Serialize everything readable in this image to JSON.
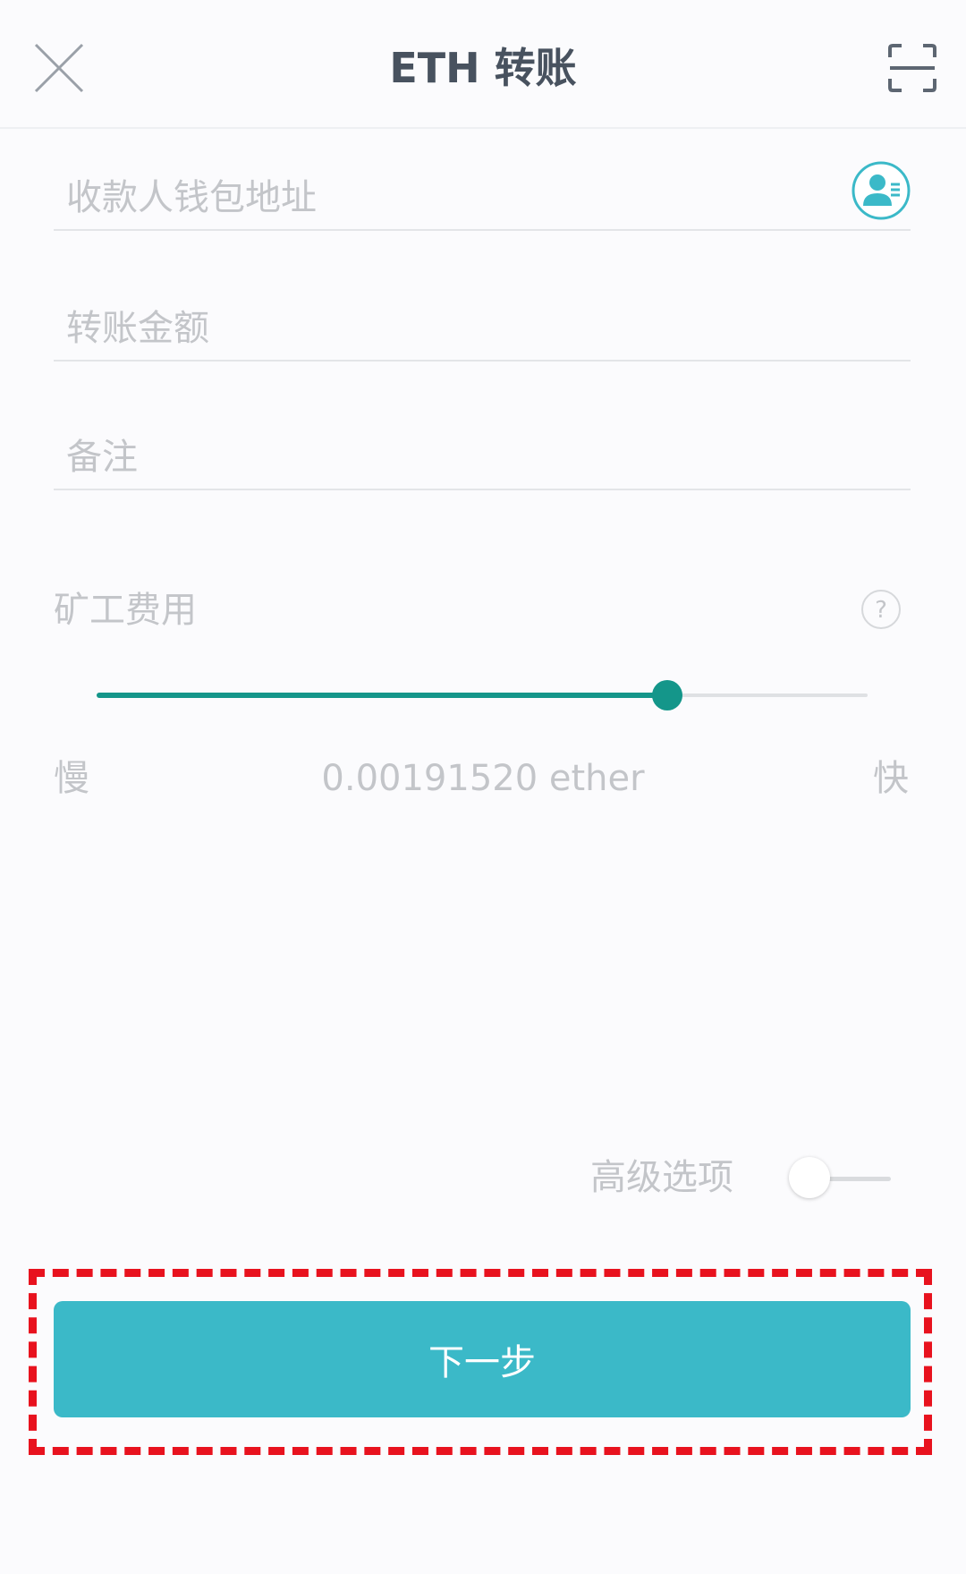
{
  "header": {
    "title": "ETH 转账",
    "close_icon": "close-icon",
    "scan_icon": "scan-icon"
  },
  "form": {
    "address_placeholder": "收款人钱包地址",
    "amount_placeholder": "转账金额",
    "memo_placeholder": "备注",
    "contact_icon": "contact-book-icon"
  },
  "fee": {
    "label": "矿工费用",
    "help_icon": "help-icon",
    "slider_level": 0.74,
    "slow_label": "慢",
    "fast_label": "快",
    "value": "0.00191520 ether"
  },
  "advanced": {
    "label": "高级选项",
    "enabled": false
  },
  "next_button": {
    "label": "下一步"
  },
  "colors": {
    "accent": "#3bb9c8",
    "slider": "#14968a",
    "highlight": "#e8121e",
    "title": "#48525f",
    "placeholder": "#c3c5c9"
  }
}
